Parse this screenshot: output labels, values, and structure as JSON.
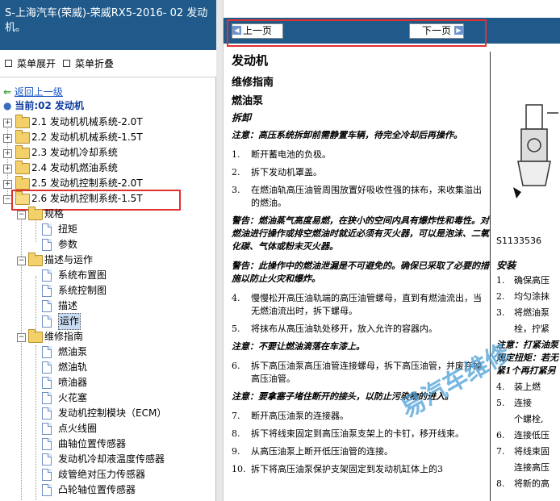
{
  "window": {
    "title": "S-上海汽车(荣威)-荣威RX5-2016- 02 发动机。"
  },
  "menu": {
    "expand_label": "菜单展开",
    "collapse_label": "菜单折叠"
  },
  "tree": {
    "back_label": "返回上一级",
    "current_label": "当前:02 发动机",
    "sections": [
      {
        "label": "2.1 发动机机械系统-2.0T"
      },
      {
        "label": "2.2 发动机机械系统-1.5T"
      },
      {
        "label": "2.3 发动机冷却系统"
      },
      {
        "label": "2.4 发动机燃油系统"
      },
      {
        "label": "2.5 发动机控制系统-2.0T"
      },
      {
        "label": "2.6 发动机控制系统-1.5T"
      }
    ],
    "sub": {
      "spec": "规格",
      "torque": "扭矩",
      "params": "参数",
      "desc_op": "描述与运作",
      "layout": "系统布置图",
      "control": "系统控制图",
      "desc": "描述",
      "operation": "运作",
      "repair": "维修指南",
      "repair_items": [
        "燃油泵",
        "燃油轨",
        "喷油器",
        "火花塞",
        "发动机控制模块（ECM）",
        "点火线圈",
        "曲轴位置传感器",
        "发动机冷却液温度传感器",
        "歧管绝对压力传感器",
        "凸轮轴位置传感器"
      ]
    }
  },
  "nav": {
    "prev": "上一页",
    "next": "下一页"
  },
  "content": {
    "h1": "发动机",
    "h2": "维修指南",
    "h2b": "燃油泵",
    "h3": "拆卸",
    "note1": "注意：高压系统拆卸前需静置车辆，待完全冷却后再操作。",
    "steps_a": [
      {
        "n": "1.",
        "t": "断开蓄电池的负极。"
      },
      {
        "n": "2.",
        "t": "拆下发动机罩盖。"
      },
      {
        "n": "3.",
        "t": "在燃油轨高压油管周围放置好吸收性强的抹布，来收集溢出的燃油。"
      }
    ],
    "warn1": "警告：燃油蒸气高度易燃，在狭小的空间内具有爆炸性和毒性。对燃油进行操作或排空燃油时就近必须有灭火器，可以是泡沫、二氧化碳、气体或粉末灭火器。",
    "warn2": "警告：此操作中的燃油泄漏是不可避免的。确保已采取了必要的措施以防止火灾和爆炸。",
    "steps_b": [
      {
        "n": "4.",
        "t": "慢慢松开高压油轨端的高压油管螺母，直到有燃油流出，当无燃油流出时，拆下螺母。"
      },
      {
        "n": "5.",
        "t": "将抹布从高压油轨处移开，放入允许的容器内。"
      }
    ],
    "note2": "注意：不要让燃油滴落在车漆上。",
    "steps_c": [
      {
        "n": "6.",
        "t": "拆下高压油泵高压油管连接螺母，拆下高压油管，并废弃掉高压油管。"
      }
    ],
    "note3": "注意：要拿塞子堵住断开的接头，以防止污染物的进入。",
    "steps_d": [
      {
        "n": "7.",
        "t": "断开高压油泵的连接器。"
      },
      {
        "n": "8.",
        "t": "拆下将线束固定到高压油泵支架上的卡钉，移开线束。"
      },
      {
        "n": "9.",
        "t": "从高压油泵上断开低压油管的连接。"
      },
      {
        "n": "10.",
        "t": "拆下将高压油泵保护支架固定到发动机缸体上的3"
      }
    ],
    "figure_id": "S1133536",
    "install": "安装",
    "rsteps": [
      {
        "n": "1.",
        "t": "确保高压"
      },
      {
        "n": "2.",
        "t": "均匀涂抹"
      },
      {
        "n": "3.",
        "t": "将燃油泵"
      },
      {
        "n": "",
        "t": "栓，拧紧"
      }
    ],
    "rnote": "注意：打紧油泵",
    "rnote2": "规定扭矩：若无",
    "rnote3": "紧1个再打紧另",
    "rsteps2": [
      {
        "n": "4.",
        "t": "装上燃"
      },
      {
        "n": "5.",
        "t": "连接"
      },
      {
        "n": "",
        "t": "个螺栓,"
      },
      {
        "n": "6.",
        "t": "连接低压"
      },
      {
        "n": "7.",
        "t": "将线束固"
      },
      {
        "n": "",
        "t": "连接高压"
      },
      {
        "n": "8.",
        "t": "将新的高"
      }
    ],
    "watermark": "易汽车维修"
  },
  "colors": {
    "title_bg": "#1f5a8b",
    "highlight": "#e03030",
    "link": "#1a57c4"
  }
}
